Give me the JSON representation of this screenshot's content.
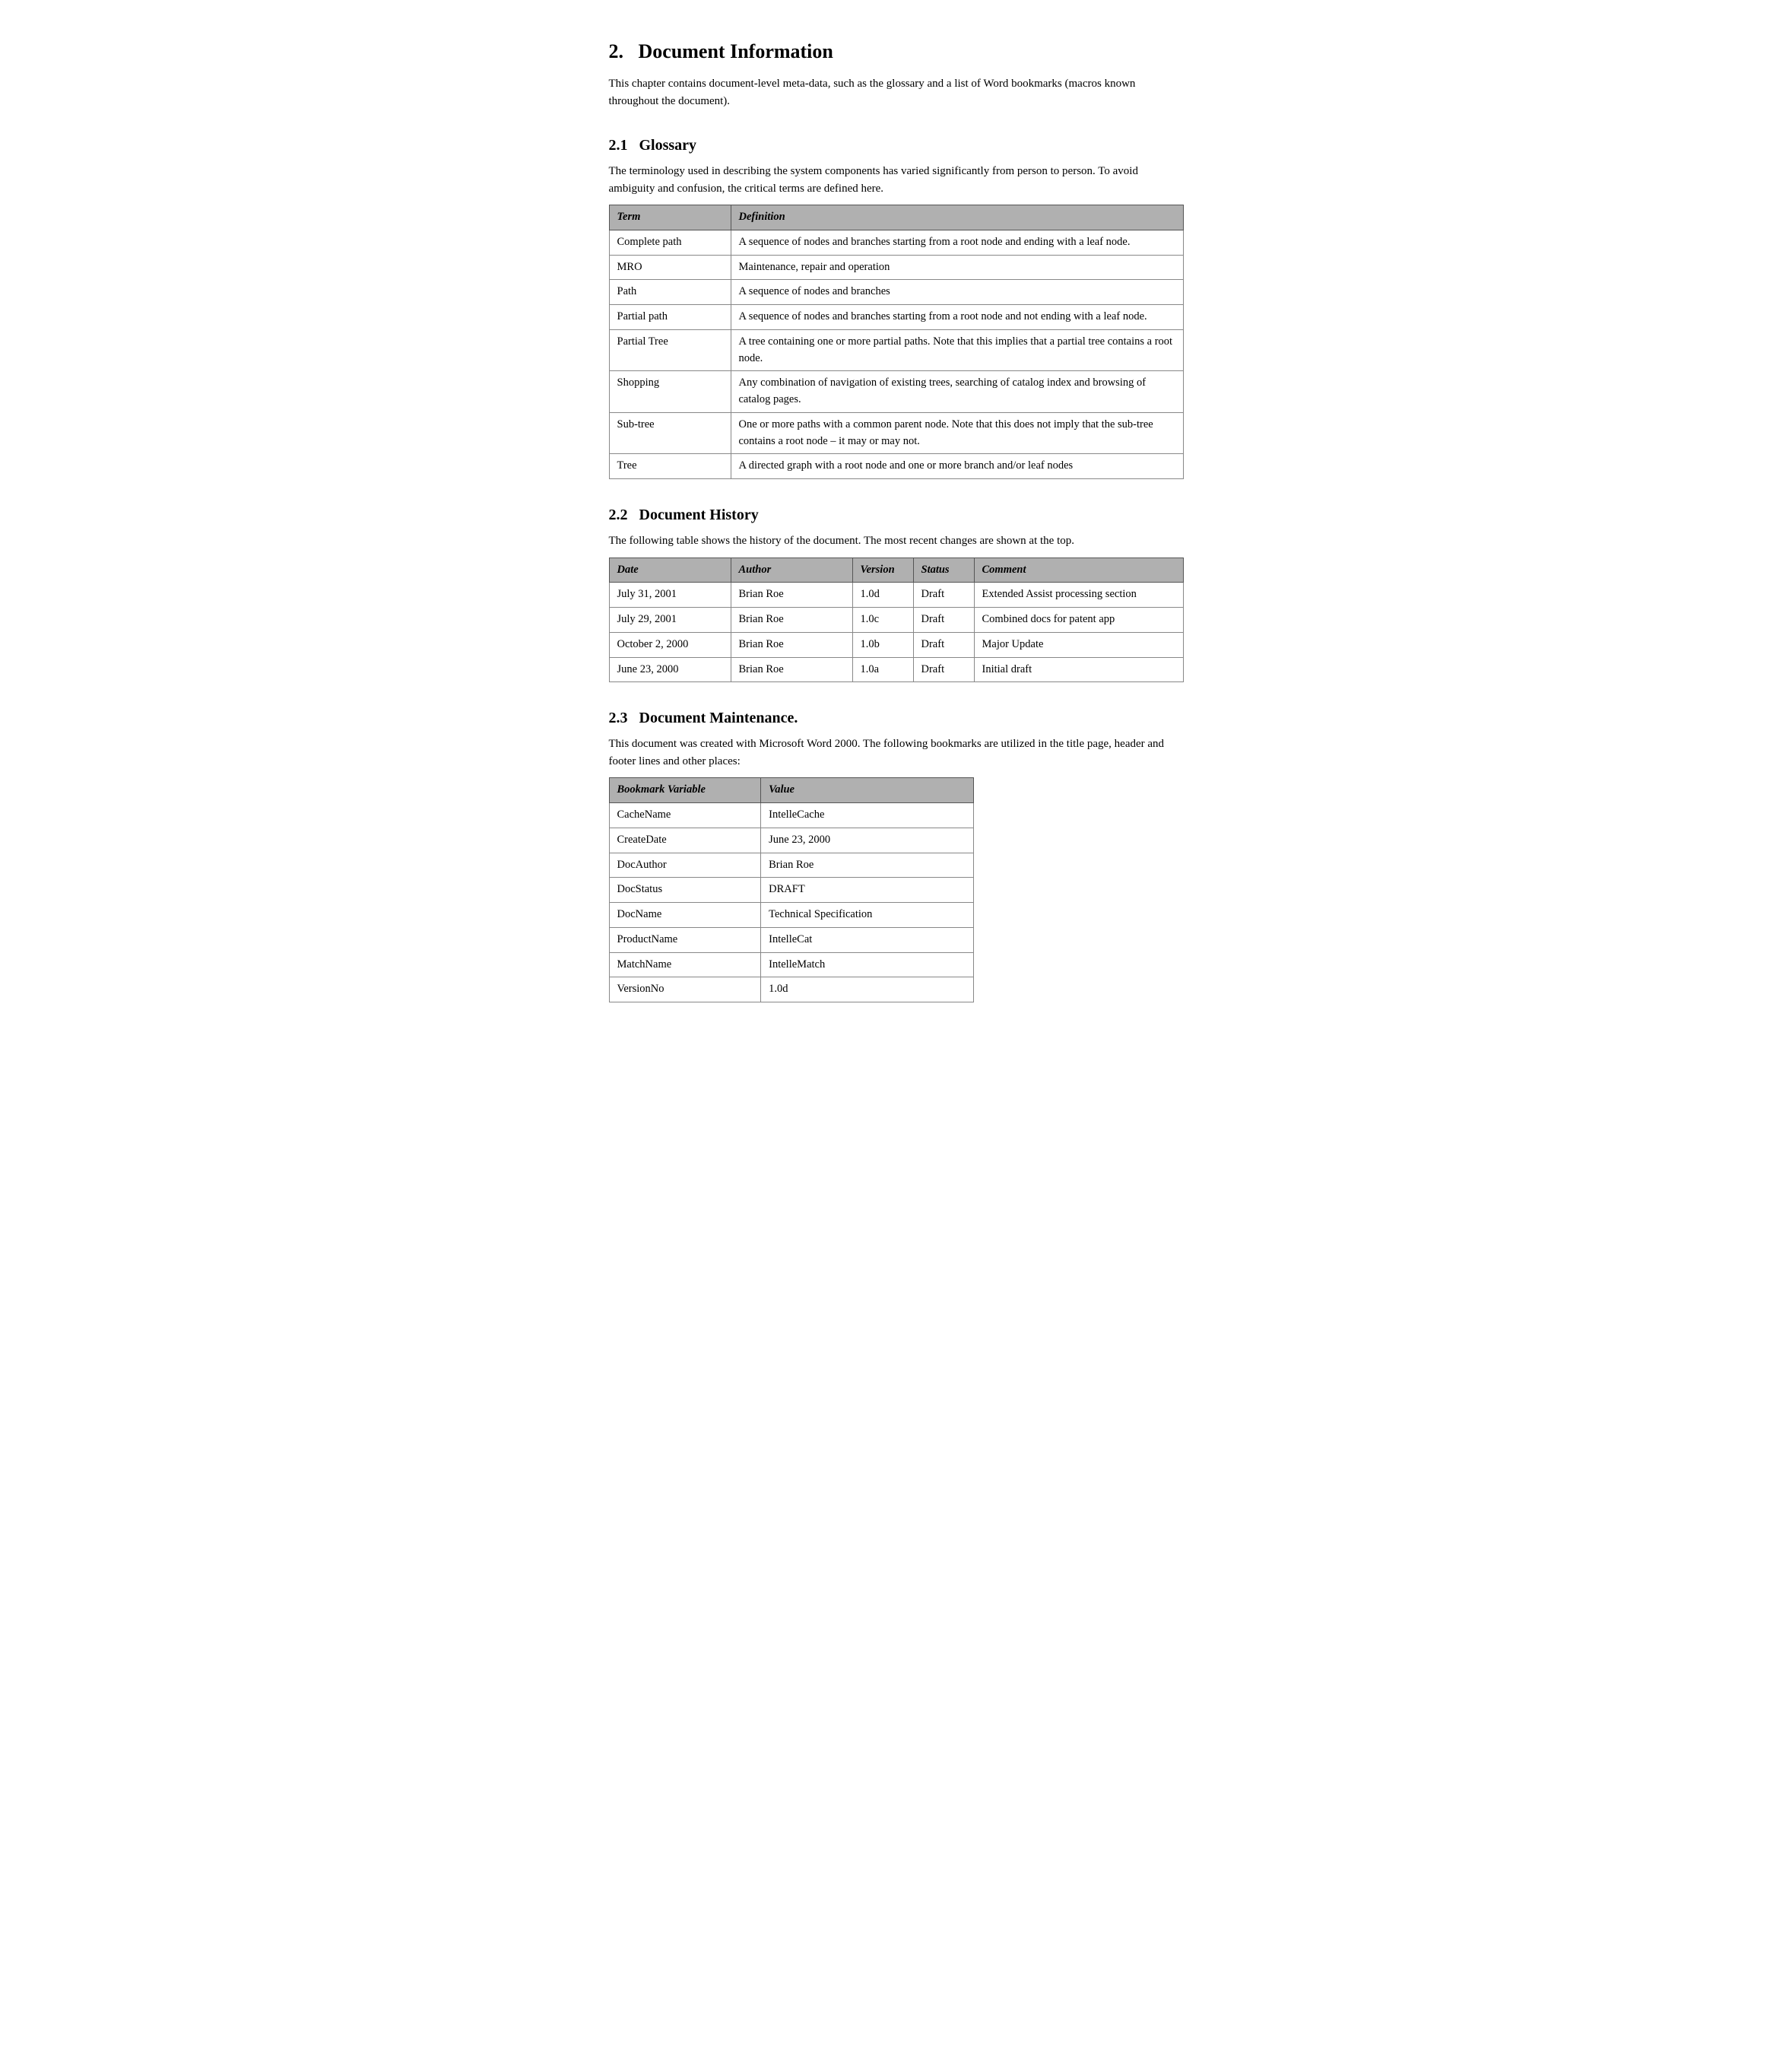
{
  "chapter": {
    "number": "2.",
    "title": "Document Information",
    "intro": "This chapter contains document-level meta-data, such as the glossary and a list of Word bookmarks (macros known throughout the document)."
  },
  "section21": {
    "number": "2.1",
    "title": "Glossary",
    "intro": "The terminology used in describing the system components has varied significantly from person to person.  To avoid ambiguity and confusion, the critical terms are defined here.",
    "table_headers": [
      "Term",
      "Definition"
    ],
    "rows": [
      {
        "term": "Complete path",
        "definition": "A sequence of nodes and branches starting from a root node and ending with a leaf node."
      },
      {
        "term": "MRO",
        "definition": "Maintenance, repair and operation"
      },
      {
        "term": "Path",
        "definition": "A sequence of nodes and branches"
      },
      {
        "term": "Partial path",
        "definition": "A sequence of nodes and branches starting from a root node and not ending with a leaf node."
      },
      {
        "term": "Partial Tree",
        "definition": "A tree containing one or more partial paths.  Note that this implies that a partial tree contains a root node."
      },
      {
        "term": "Shopping",
        "definition": "Any combination of navigation of existing trees, searching of catalog index and browsing of catalog pages."
      },
      {
        "term": "Sub-tree",
        "definition": "One or more paths with a common parent node.  Note that this does not imply that the sub-tree contains a root node – it may or may not."
      },
      {
        "term": "Tree",
        "definition": "A directed graph with a root node and one or more branch and/or leaf nodes"
      }
    ]
  },
  "section22": {
    "number": "2.2",
    "title": "Document History",
    "intro": "The following table shows the history of the document.  The most recent changes are shown at the top.",
    "table_headers": [
      "Date",
      "Author",
      "Version",
      "Status",
      "Comment"
    ],
    "rows": [
      {
        "date": "July 31, 2001",
        "author": "Brian Roe",
        "version": "1.0d",
        "status": "Draft",
        "comment": "Extended Assist processing section"
      },
      {
        "date": "July 29, 2001",
        "author": "Brian Roe",
        "version": "1.0c",
        "status": "Draft",
        "comment": "Combined docs for patent app"
      },
      {
        "date": "October 2, 2000",
        "author": "Brian Roe",
        "version": "1.0b",
        "status": "Draft",
        "comment": "Major Update"
      },
      {
        "date": "June 23, 2000",
        "author": "Brian Roe",
        "version": "1.0a",
        "status": "Draft",
        "comment": "Initial draft"
      }
    ]
  },
  "section23": {
    "number": "2.3",
    "title": "Document Maintenance.",
    "intro": "This document was created with Microsoft Word 2000. The following bookmarks are utilized in the title page, header and footer lines and other places:",
    "table_headers": [
      "Bookmark Variable",
      "Value"
    ],
    "rows": [
      {
        "variable": "CacheName",
        "value": "IntelleCache"
      },
      {
        "variable": "CreateDate",
        "value": "June 23, 2000"
      },
      {
        "variable": "DocAuthor",
        "value": "Brian Roe"
      },
      {
        "variable": "DocStatus",
        "value": "DRAFT"
      },
      {
        "variable": "DocName",
        "value": "Technical Specification"
      },
      {
        "variable": "ProductName",
        "value": "IntelleCat"
      },
      {
        "variable": "MatchName",
        "value": "IntelleMatch"
      },
      {
        "variable": "VersionNo",
        "value": "1.0d"
      }
    ]
  }
}
